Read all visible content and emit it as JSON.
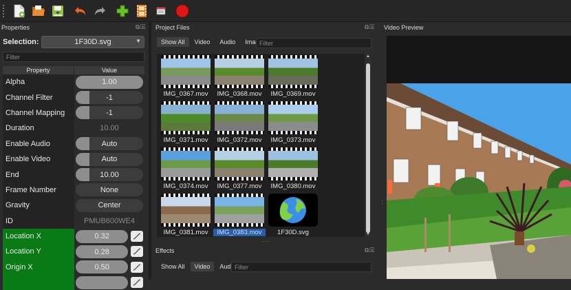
{
  "toolbar": {
    "buttons": [
      {
        "name": "new-project-button",
        "icon": "new-file-icon"
      },
      {
        "name": "open-project-button",
        "icon": "folder-icon"
      },
      {
        "name": "save-project-button",
        "icon": "save-icon"
      },
      {
        "name": "undo-button",
        "icon": "undo-icon"
      },
      {
        "name": "redo-button",
        "icon": "redo-icon"
      },
      {
        "name": "import-files-button",
        "icon": "plus-icon"
      },
      {
        "name": "choose-profile-button",
        "icon": "film-icon"
      },
      {
        "name": "fullscreen-button",
        "icon": "fullscreen-icon"
      },
      {
        "name": "export-video-button",
        "icon": "record-icon"
      }
    ]
  },
  "properties": {
    "title": "Properties",
    "selection_label": "Selection:",
    "selection_value": "1F30D.svg",
    "filter_placeholder": "Filter",
    "col_property": "Property",
    "col_value": "Value",
    "rows": [
      {
        "name": "Alpha",
        "value": "1.00",
        "style": "full",
        "green": false,
        "kf": false
      },
      {
        "name": "Channel Filter",
        "value": "-1",
        "style": "part",
        "green": false,
        "kf": false
      },
      {
        "name": "Channel Mapping",
        "value": "-1",
        "style": "part",
        "green": false,
        "kf": false
      },
      {
        "name": "Duration",
        "value": "10.00",
        "style": "plain",
        "green": false,
        "kf": false
      },
      {
        "name": "Enable Audio",
        "value": "Auto",
        "style": "part",
        "green": false,
        "kf": false
      },
      {
        "name": "Enable Video",
        "value": "Auto",
        "style": "part",
        "green": false,
        "kf": false
      },
      {
        "name": "End",
        "value": "10.00",
        "style": "part",
        "green": false,
        "kf": false
      },
      {
        "name": "Frame Number",
        "value": "None",
        "style": "none",
        "green": false,
        "kf": false
      },
      {
        "name": "Gravity",
        "value": "Center",
        "style": "none",
        "green": false,
        "kf": false
      },
      {
        "name": "ID",
        "value": "PMUB600WE4",
        "style": "plain",
        "green": false,
        "kf": false
      },
      {
        "name": "Location X",
        "value": "0.32",
        "style": "full",
        "green": true,
        "kf": true
      },
      {
        "name": "Location Y",
        "value": "0.28",
        "style": "full",
        "green": true,
        "kf": true
      },
      {
        "name": "Origin X",
        "value": "0.50",
        "style": "full",
        "green": true,
        "kf": true
      },
      {
        "name": "",
        "value": "",
        "style": "full",
        "green": true,
        "kf": true
      }
    ]
  },
  "project_files": {
    "title": "Project Files",
    "tabs": [
      "Show All",
      "Video",
      "Audio",
      "Image"
    ],
    "active_tab": "Show All",
    "filter_placeholder": "Filter",
    "files": [
      {
        "label": "IMG_0367.mov",
        "scene": "road"
      },
      {
        "label": "IMG_0368.mov",
        "scene": "green"
      },
      {
        "label": "IMG_0369.mov",
        "scene": "green2"
      },
      {
        "label": "IMG_0371.mov",
        "scene": "grass"
      },
      {
        "label": "IMG_0372.mov",
        "scene": "road2"
      },
      {
        "label": "IMG_0373.mov",
        "scene": "road3"
      },
      {
        "label": "IMG_0374.mov",
        "scene": "sky"
      },
      {
        "label": "IMG_0377.mov",
        "scene": "green"
      },
      {
        "label": "IMG_0380.mov",
        "scene": "car"
      },
      {
        "label": "IMG_0381.mov",
        "scene": "house"
      },
      {
        "label": "IMG_0383.mov",
        "scene": "sky2"
      },
      {
        "label": "1F30D.svg",
        "scene": "globe"
      }
    ],
    "selected_file": "IMG_0383.mov"
  },
  "effects": {
    "title": "Effects",
    "tabs": [
      "Show All",
      "Video",
      "Audio"
    ],
    "active_tab": "Video",
    "filter_placeholder": "Filter"
  },
  "preview": {
    "title": "Video Preview"
  },
  "colors": {
    "accent_green": "#0a7a16",
    "selection_blue": "#2a5ea8",
    "record_red": "#e01515"
  }
}
